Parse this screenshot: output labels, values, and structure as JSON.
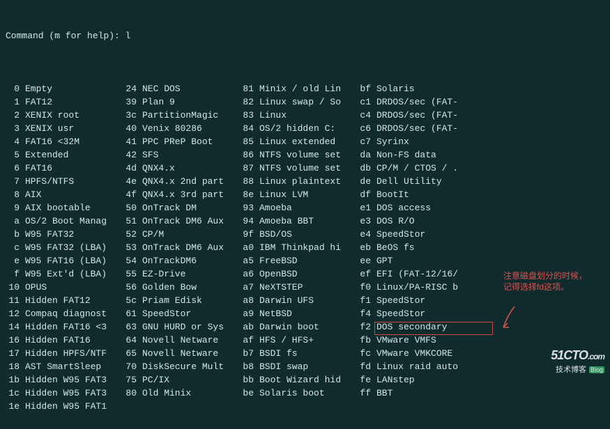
{
  "prompt": "Command (m for help): l",
  "columns": [
    [
      {
        "hex": " 0",
        "name": "Empty"
      },
      {
        "hex": " 1",
        "name": "FAT12"
      },
      {
        "hex": " 2",
        "name": "XENIX root"
      },
      {
        "hex": " 3",
        "name": "XENIX usr"
      },
      {
        "hex": " 4",
        "name": "FAT16 <32M"
      },
      {
        "hex": " 5",
        "name": "Extended"
      },
      {
        "hex": " 6",
        "name": "FAT16"
      },
      {
        "hex": " 7",
        "name": "HPFS/NTFS"
      },
      {
        "hex": " 8",
        "name": "AIX"
      },
      {
        "hex": " 9",
        "name": "AIX bootable"
      },
      {
        "hex": " a",
        "name": "OS/2 Boot Manag"
      },
      {
        "hex": " b",
        "name": "W95 FAT32"
      },
      {
        "hex": " c",
        "name": "W95 FAT32 (LBA)"
      },
      {
        "hex": " e",
        "name": "W95 FAT16 (LBA)"
      },
      {
        "hex": " f",
        "name": "W95 Ext'd (LBA)"
      },
      {
        "hex": "10",
        "name": "OPUS"
      },
      {
        "hex": "11",
        "name": "Hidden FAT12"
      },
      {
        "hex": "12",
        "name": "Compaq diagnost"
      },
      {
        "hex": "14",
        "name": "Hidden FAT16 <3"
      },
      {
        "hex": "16",
        "name": "Hidden FAT16"
      },
      {
        "hex": "17",
        "name": "Hidden HPFS/NTF"
      },
      {
        "hex": "18",
        "name": "AST SmartSleep"
      },
      {
        "hex": "1b",
        "name": "Hidden W95 FAT3"
      },
      {
        "hex": "1c",
        "name": "Hidden W95 FAT3"
      },
      {
        "hex": "1e",
        "name": "Hidden W95 FAT1"
      }
    ],
    [
      {
        "hex": "24",
        "name": "NEC DOS"
      },
      {
        "hex": "39",
        "name": "Plan 9"
      },
      {
        "hex": "3c",
        "name": "PartitionMagic"
      },
      {
        "hex": "40",
        "name": "Venix 80286"
      },
      {
        "hex": "41",
        "name": "PPC PReP Boot"
      },
      {
        "hex": "42",
        "name": "SFS"
      },
      {
        "hex": "4d",
        "name": "QNX4.x"
      },
      {
        "hex": "4e",
        "name": "QNX4.x 2nd part"
      },
      {
        "hex": "4f",
        "name": "QNX4.x 3rd part"
      },
      {
        "hex": "50",
        "name": "OnTrack DM"
      },
      {
        "hex": "51",
        "name": "OnTrack DM6 Aux"
      },
      {
        "hex": "52",
        "name": "CP/M"
      },
      {
        "hex": "53",
        "name": "OnTrack DM6 Aux"
      },
      {
        "hex": "54",
        "name": "OnTrackDM6"
      },
      {
        "hex": "55",
        "name": "EZ-Drive"
      },
      {
        "hex": "56",
        "name": "Golden Bow"
      },
      {
        "hex": "5c",
        "name": "Priam Edisk"
      },
      {
        "hex": "61",
        "name": "SpeedStor"
      },
      {
        "hex": "63",
        "name": "GNU HURD or Sys"
      },
      {
        "hex": "64",
        "name": "Novell Netware"
      },
      {
        "hex": "65",
        "name": "Novell Netware"
      },
      {
        "hex": "70",
        "name": "DiskSecure Mult"
      },
      {
        "hex": "75",
        "name": "PC/IX"
      },
      {
        "hex": "80",
        "name": "Old Minix"
      }
    ],
    [
      {
        "hex": "81",
        "name": "Minix / old Lin"
      },
      {
        "hex": "82",
        "name": "Linux swap / So"
      },
      {
        "hex": "83",
        "name": "Linux"
      },
      {
        "hex": "84",
        "name": "OS/2 hidden C:"
      },
      {
        "hex": "85",
        "name": "Linux extended"
      },
      {
        "hex": "86",
        "name": "NTFS volume set"
      },
      {
        "hex": "87",
        "name": "NTFS volume set"
      },
      {
        "hex": "88",
        "name": "Linux plaintext"
      },
      {
        "hex": "8e",
        "name": "Linux LVM"
      },
      {
        "hex": "93",
        "name": "Amoeba"
      },
      {
        "hex": "94",
        "name": "Amoeba BBT"
      },
      {
        "hex": "9f",
        "name": "BSD/OS"
      },
      {
        "hex": "a0",
        "name": "IBM Thinkpad hi"
      },
      {
        "hex": "a5",
        "name": "FreeBSD"
      },
      {
        "hex": "a6",
        "name": "OpenBSD"
      },
      {
        "hex": "a7",
        "name": "NeXTSTEP"
      },
      {
        "hex": "a8",
        "name": "Darwin UFS"
      },
      {
        "hex": "a9",
        "name": "NetBSD"
      },
      {
        "hex": "ab",
        "name": "Darwin boot"
      },
      {
        "hex": "af",
        "name": "HFS / HFS+"
      },
      {
        "hex": "b7",
        "name": "BSDI fs"
      },
      {
        "hex": "b8",
        "name": "BSDI swap"
      },
      {
        "hex": "bb",
        "name": "Boot Wizard hid"
      },
      {
        "hex": "be",
        "name": "Solaris boot"
      }
    ],
    [
      {
        "hex": "bf",
        "name": "Solaris"
      },
      {
        "hex": "c1",
        "name": "DRDOS/sec (FAT-"
      },
      {
        "hex": "c4",
        "name": "DRDOS/sec (FAT-"
      },
      {
        "hex": "c6",
        "name": "DRDOS/sec (FAT-"
      },
      {
        "hex": "c7",
        "name": "Syrinx"
      },
      {
        "hex": "da",
        "name": "Non-FS data"
      },
      {
        "hex": "db",
        "name": "CP/M / CTOS / ."
      },
      {
        "hex": "de",
        "name": "Dell Utility"
      },
      {
        "hex": "df",
        "name": "BootIt"
      },
      {
        "hex": "e1",
        "name": "DOS access"
      },
      {
        "hex": "e3",
        "name": "DOS R/O"
      },
      {
        "hex": "e4",
        "name": "SpeedStor"
      },
      {
        "hex": "eb",
        "name": "BeOS fs"
      },
      {
        "hex": "ee",
        "name": "GPT"
      },
      {
        "hex": "ef",
        "name": "EFI (FAT-12/16/"
      },
      {
        "hex": "f0",
        "name": "Linux/PA-RISC b"
      },
      {
        "hex": "f1",
        "name": "SpeedStor"
      },
      {
        "hex": "f4",
        "name": "SpeedStor"
      },
      {
        "hex": "f2",
        "name": "DOS secondary"
      },
      {
        "hex": "fb",
        "name": "VMware VMFS"
      },
      {
        "hex": "fc",
        "name": "VMware VMKCORE"
      },
      {
        "hex": "fd",
        "name": "Linux raid auto"
      },
      {
        "hex": "fe",
        "name": "LANstep"
      },
      {
        "hex": "ff",
        "name": "BBT"
      }
    ]
  ],
  "annotation": "注意磁盘划分的时候，记得选择fd这项。",
  "logo": {
    "main": "51CTO",
    "suffix": ".com",
    "sub": "技术博客",
    "blog": "Blog"
  }
}
